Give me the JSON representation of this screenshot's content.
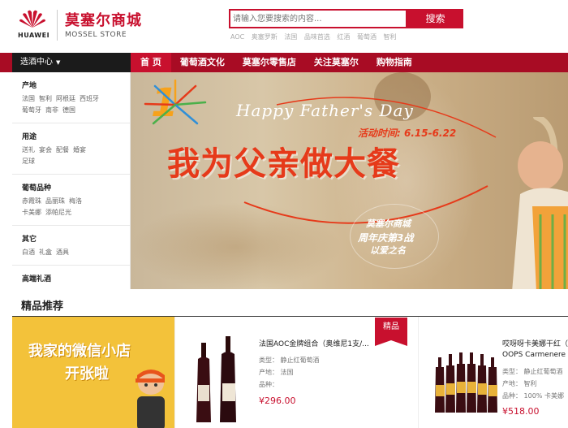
{
  "header": {
    "brand_name": "HUAWEI",
    "store_name_cn": "莫塞尔商城",
    "store_name_en": "MOSSEL STORE",
    "search_placeholder": "请输入您要搜索的内容...",
    "search_button": "搜索",
    "hot_words": [
      "AOC",
      "奥塞罗斯",
      "法国",
      "品味首选",
      "红酒",
      "葡萄酒",
      "智利"
    ]
  },
  "nav": {
    "category_button": "选酒中心",
    "items": [
      "首 页",
      "葡萄酒文化",
      "莫塞尔零售店",
      "关注莫塞尔",
      "购物指南"
    ]
  },
  "sidebar": {
    "groups": [
      {
        "title": "产地",
        "links": [
          "法国",
          "智利",
          "阿根廷",
          "西班牙",
          "葡萄牙",
          "南非",
          "德国"
        ]
      },
      {
        "title": "用途",
        "links": [
          "送礼",
          "宴会",
          "配餐",
          "婚宴",
          "足球"
        ]
      },
      {
        "title": "葡萄品种",
        "links": [
          "赤霞珠",
          "品丽珠",
          "梅洛",
          "卡美娜",
          "添帕尼光"
        ]
      },
      {
        "title": "其它",
        "links": [
          "白酒",
          "礼盒",
          "酒具"
        ]
      },
      {
        "title": "高端礼酒",
        "links": []
      }
    ]
  },
  "banner": {
    "number": "1",
    "english": "Happy Father's Day",
    "activity_time": "活动时间: 6.15-6.22",
    "slogan": "我为父亲做大餐",
    "badge_store": "莫塞尔商城",
    "badge_anniv": "周年庆第3战",
    "badge_love": "以爱之名"
  },
  "recommend": {
    "title": "精品推荐",
    "wechat_line1": "我家的微信小店",
    "wechat_line2": "开张啦",
    "premium_tag": "精品",
    "products": [
      {
        "name": "法国AOC金牌组合（奥维尼1支/...",
        "type": "类型： 静止红葡萄酒",
        "origin": "产地： 法国",
        "variety": "品种：",
        "price": "¥296.00"
      },
      {
        "name": "哎呀呀卡美娜干红（",
        "name_en": "OOPS Carmenere",
        "type": "类型： 静止红葡萄酒",
        "origin": "产地： 智利",
        "variety": "品种： 100% 卡美娜",
        "price": "¥518.00"
      }
    ]
  },
  "colors": {
    "brand_red": "#c8102e",
    "nav_dark_red": "#a80c24",
    "banner_orange": "#e63a1a",
    "wechat_yellow": "#f3c23a"
  }
}
